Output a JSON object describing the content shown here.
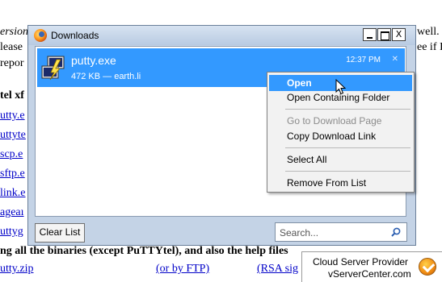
{
  "background_page": {
    "fragments": {
      "version_italic": "ersion",
      "please": "lease",
      "report": "repor",
      "well": "well. I",
      "see_if": "ee if I",
      "heading_tel": "tel xf",
      "links": [
        "utty.e",
        "uttyte",
        "scp.e",
        "sftp.e",
        "link.e",
        "ageaı",
        "uttyg"
      ],
      "bottom_bold": "ng all the binaries (except PuTTYtel), and also the help files",
      "putty_zip": "utty.zip",
      "or_ftp": "(or by FTP)",
      "rsa_sig": "(RSA sig"
    }
  },
  "window": {
    "title": "Downloads",
    "buttons": {
      "minimize": "_",
      "maximize": "□",
      "close": "X"
    }
  },
  "download": {
    "filename": "putty.exe",
    "status": "472 KB — earth.li",
    "time": "12:37 PM",
    "cancel_glyph": "✕"
  },
  "footer": {
    "clear_list_label": "Clear List",
    "search_placeholder": "Search..."
  },
  "context_menu": {
    "items": [
      {
        "label": "Open",
        "highlighted": true,
        "enabled": true
      },
      {
        "label": "Open Containing Folder",
        "highlighted": false,
        "enabled": true
      },
      {
        "label": "Go to Download Page",
        "highlighted": false,
        "enabled": false
      },
      {
        "label": "Copy Download Link",
        "highlighted": false,
        "enabled": true
      },
      {
        "label": "Select All",
        "highlighted": false,
        "enabled": true
      },
      {
        "label": "Remove From List",
        "highlighted": false,
        "enabled": true
      }
    ]
  },
  "ad_badge": {
    "line1": "Cloud Server Provider",
    "line2": "vServerCenter.com"
  },
  "colors": {
    "selection": "#3399ff",
    "window_frame": "#c4d3e6",
    "link": "#0000c8"
  },
  "icons": [
    "firefox-icon",
    "putty-icon",
    "search-icon",
    "mouse-cursor-icon",
    "vservercenter-logo-icon"
  ]
}
